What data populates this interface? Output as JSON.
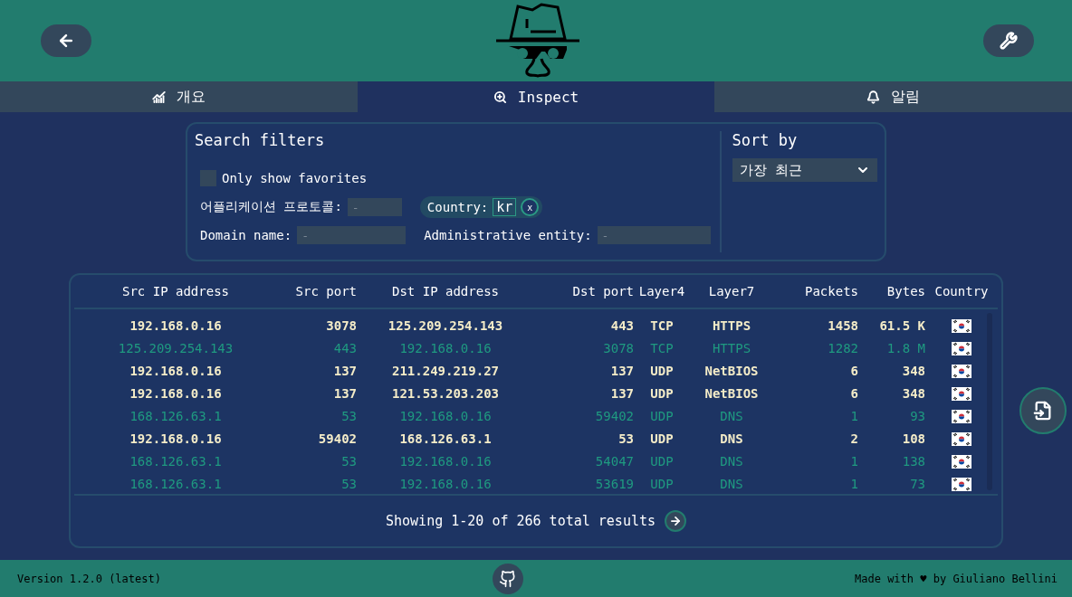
{
  "tabs": [
    {
      "label": "개요",
      "selected": false
    },
    {
      "label": "Inspect",
      "selected": true
    },
    {
      "label": "알림",
      "selected": false
    }
  ],
  "filters": {
    "title": "Search filters",
    "favorites": {
      "label": "Only show favorites",
      "checked": false
    },
    "app_protocol": {
      "label": "어플리케이션 프로토콜:",
      "placeholder": "-"
    },
    "country": {
      "label": "Country:",
      "value": "kr",
      "remove": "x"
    },
    "domain": {
      "label": "Domain name:",
      "placeholder": "-"
    },
    "entity": {
      "label": "Administrative entity:",
      "placeholder": "-"
    }
  },
  "sort": {
    "title": "Sort by",
    "value": "가장 최근"
  },
  "table": {
    "columns": [
      "Src IP address",
      "Src port",
      "Dst IP address",
      "Dst port",
      "Layer4",
      "Layer7",
      "Packets",
      "Bytes",
      "Country"
    ],
    "rows": [
      {
        "kind": "outgoing",
        "cells": [
          "192.168.0.16",
          "3078",
          "125.209.254.143",
          "443",
          "TCP",
          "HTTPS",
          "1458",
          "61.5 K"
        ]
      },
      {
        "kind": "incoming",
        "cells": [
          "125.209.254.143",
          "443",
          "192.168.0.16",
          "3078",
          "TCP",
          "HTTPS",
          "1282",
          "1.8 M"
        ]
      },
      {
        "kind": "outgoing",
        "cells": [
          "192.168.0.16",
          "137",
          "211.249.219.27",
          "137",
          "UDP",
          "NetBIOS",
          "6",
          "348"
        ]
      },
      {
        "kind": "outgoing",
        "cells": [
          "192.168.0.16",
          "137",
          "121.53.203.203",
          "137",
          "UDP",
          "NetBIOS",
          "6",
          "348"
        ]
      },
      {
        "kind": "incoming",
        "cells": [
          "168.126.63.1",
          "53",
          "192.168.0.16",
          "59402",
          "UDP",
          "DNS",
          "1",
          "93"
        ]
      },
      {
        "kind": "outgoing",
        "cells": [
          "192.168.0.16",
          "59402",
          "168.126.63.1",
          "53",
          "UDP",
          "DNS",
          "2",
          "108"
        ]
      },
      {
        "kind": "incoming",
        "cells": [
          "168.126.63.1",
          "53",
          "192.168.0.16",
          "54047",
          "UDP",
          "DNS",
          "1",
          "138"
        ]
      },
      {
        "kind": "incoming",
        "cells": [
          "168.126.63.1",
          "53",
          "192.168.0.16",
          "53619",
          "UDP",
          "DNS",
          "1",
          "73"
        ]
      }
    ],
    "summary": "Showing 1-20 of 266 total results"
  },
  "footer": {
    "version": "Version 1.2.0 (latest)",
    "credit": "Made with ♥ by Giuliano Bellini"
  }
}
